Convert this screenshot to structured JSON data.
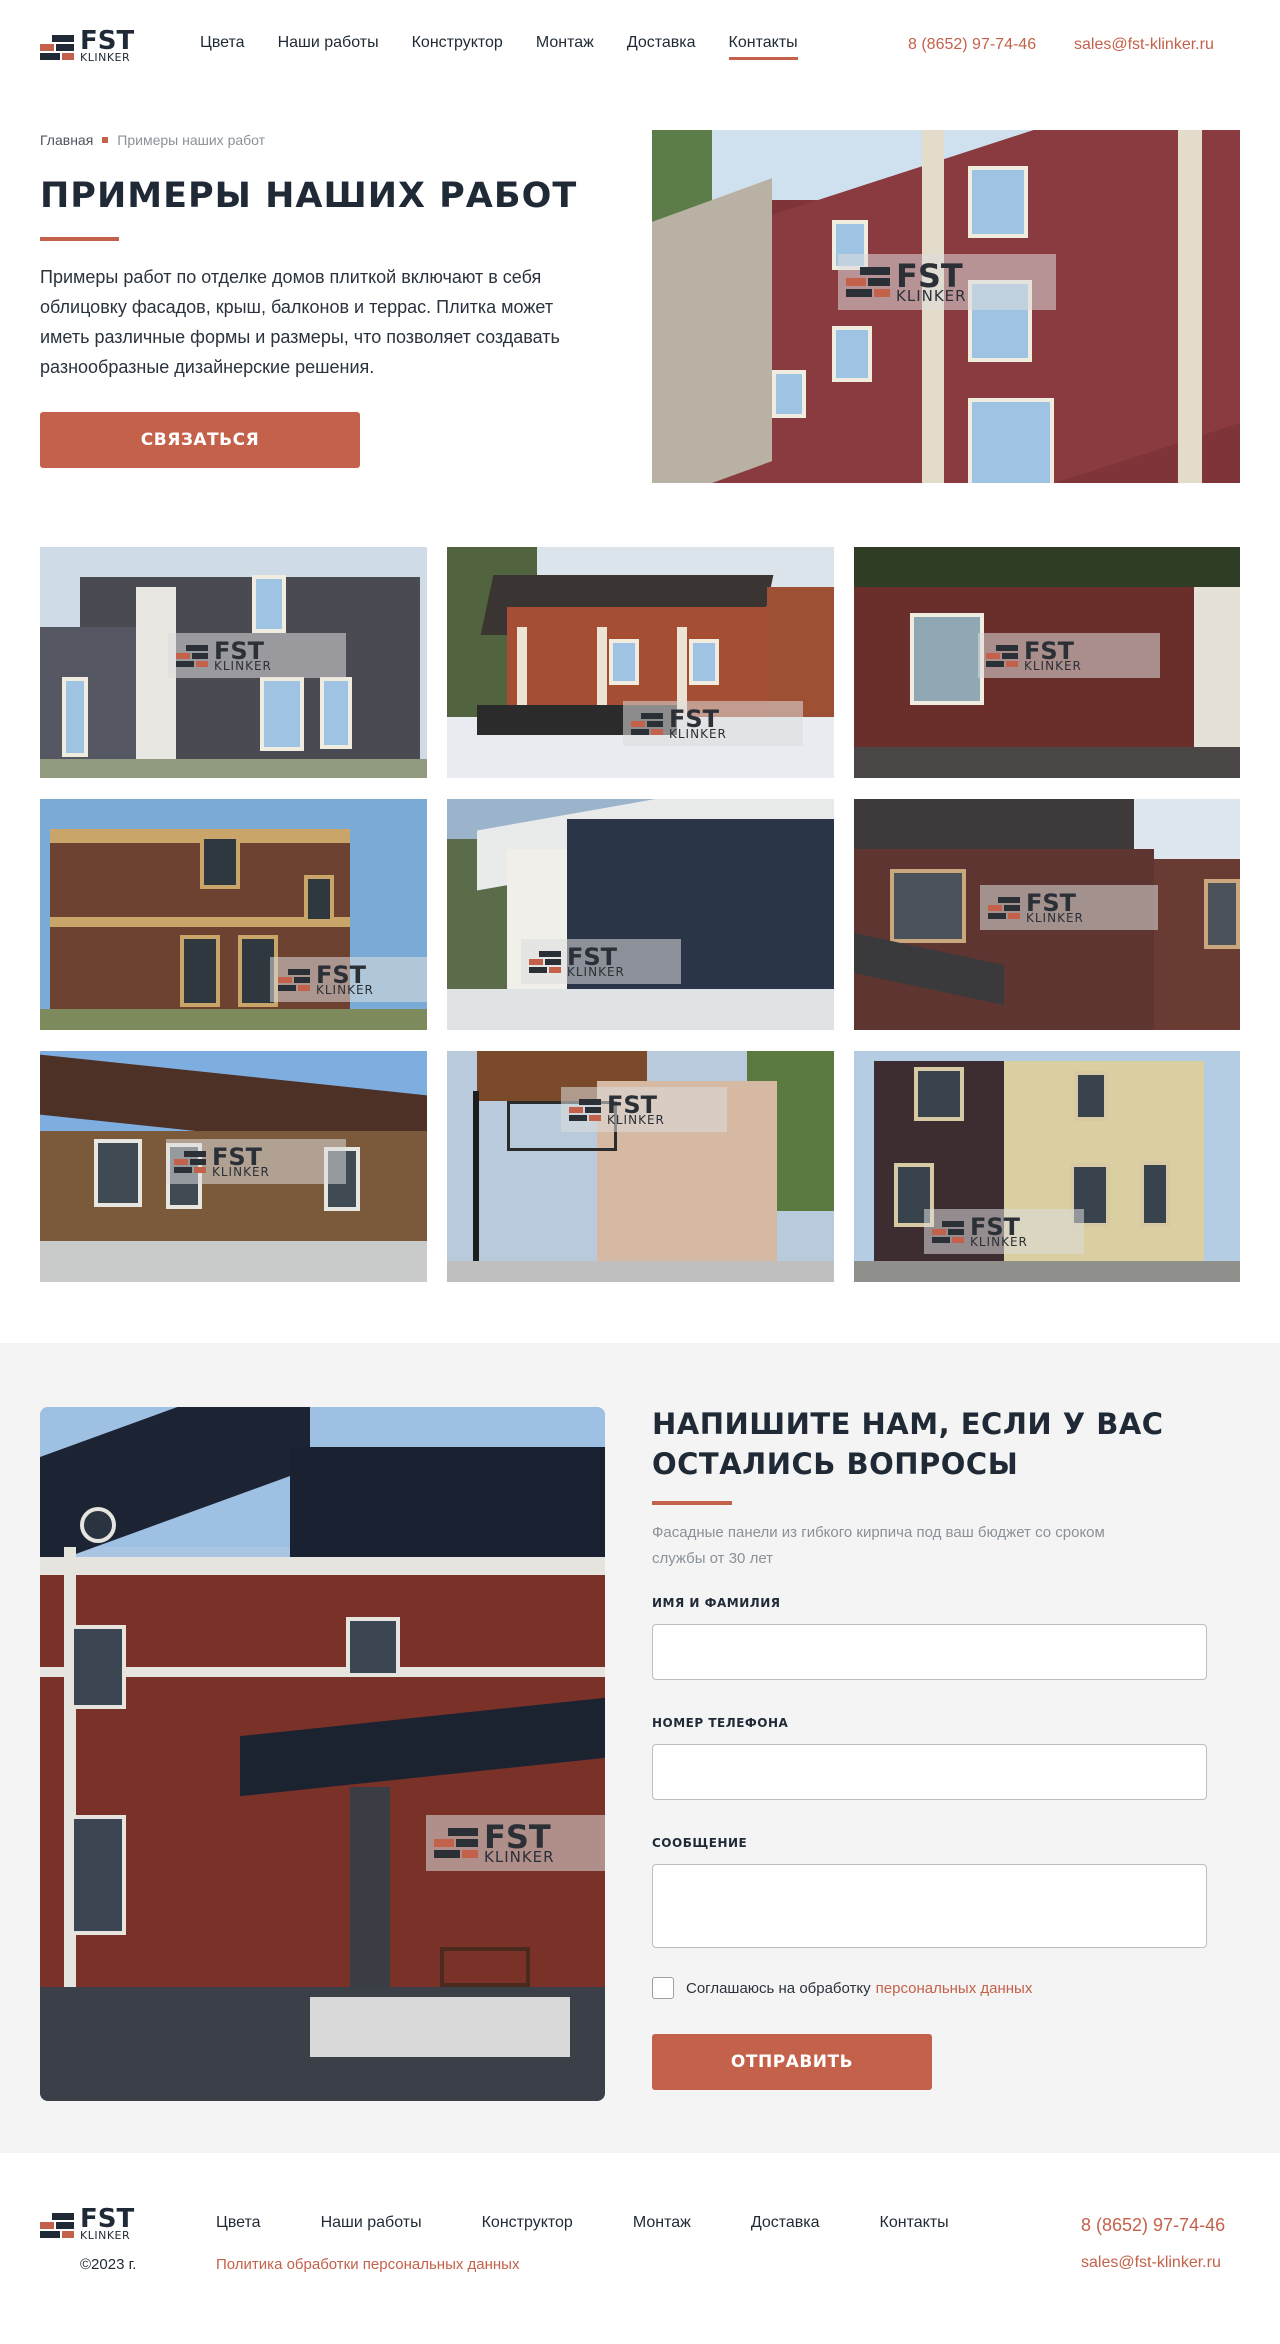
{
  "header": {
    "logo_main": "FST",
    "logo_sub": "KLINKER",
    "nav": [
      "Цвета",
      "Наши работы",
      "Конструктор",
      "Монтаж",
      "Доставка",
      "Контакты"
    ],
    "active_nav": "Контакты",
    "phone": "8 (8652) 97-74-46",
    "email": "sales@fst-klinker.ru"
  },
  "breadcrumb": {
    "home": "Главная",
    "current": "Примеры наших работ"
  },
  "hero": {
    "title": "ПРИМЕРЫ НАШИХ РАБОТ",
    "text": "Примеры работ по отделке домов плиткой включают в себя облицовку фасадов, крыш, балконов и террас. Плитка может иметь различные формы и размеры, что позволяет создавать разнообразные дизайнерские решения.",
    "button": "СВЯЗАТЬСЯ"
  },
  "watermark": {
    "main": "FST",
    "sub": "KLINKER"
  },
  "contact": {
    "title": "НАПИШИТЕ НАМ, ЕСЛИ У ВАС ОСТАЛИСЬ ВОПРОСЫ",
    "subtitle": "Фасадные панели из гибкого кирпича под ваш бюджет со сроком службы от 30 лет",
    "name_label": "ИМЯ И ФАМИЛИЯ",
    "phone_label": "НОМЕР ТЕЛЕФОНА",
    "message_label": "СООБЩЕНИЕ",
    "consent_text": "Соглашаюсь на обработку",
    "consent_link": "персональных данных",
    "submit": "ОТПРАВИТЬ"
  },
  "footer": {
    "nav": [
      "Цвета",
      "Наши работы",
      "Конструктор",
      "Монтаж",
      "Доставка",
      "Контакты"
    ],
    "copyright": "©2023 г.",
    "policy": "Политика обработки персональных данных",
    "phone": "8 (8652) 97-74-46",
    "email": "sales@fst-klinker.ru"
  },
  "colors": {
    "accent": "#c4614a",
    "dark": "#1f2a36",
    "section_bg": "#f4f4f4"
  }
}
